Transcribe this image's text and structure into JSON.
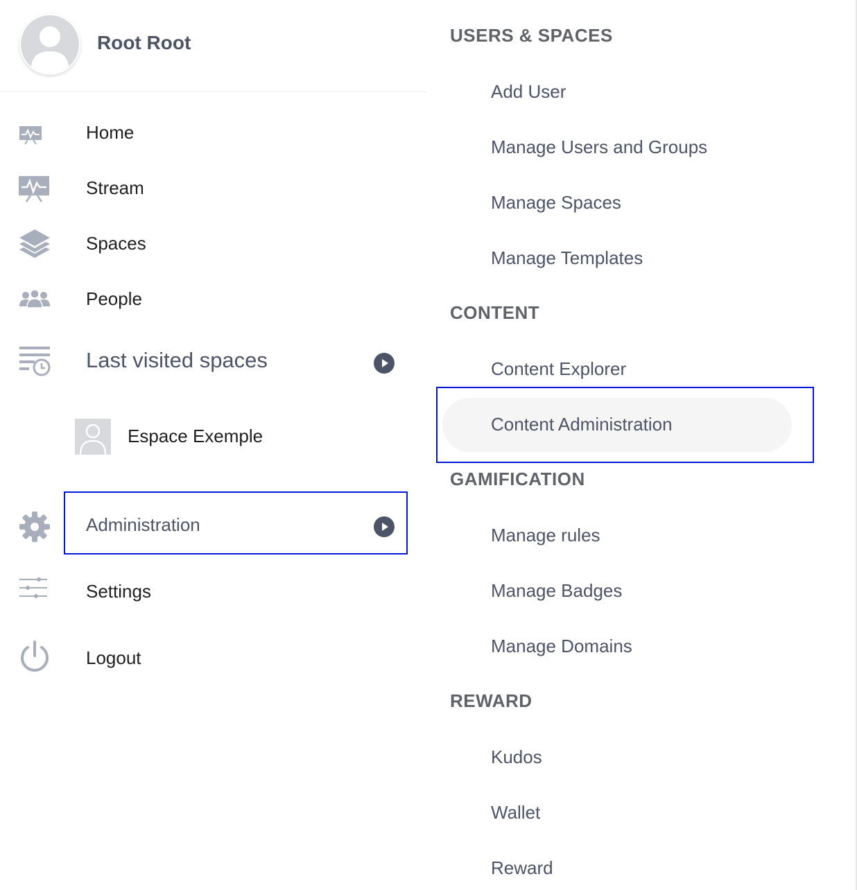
{
  "profile": {
    "name": "Root Root"
  },
  "nav": {
    "home": "Home",
    "stream": "Stream",
    "spaces": "Spaces",
    "people": "People",
    "last_visited": "Last visited spaces",
    "space_item": "Espace Exemple",
    "administration": "Administration",
    "settings": "Settings",
    "logout": "Logout"
  },
  "icons": {
    "home": "monitor-pulse-icon",
    "stream": "monitor-pulse-icon",
    "spaces": "layers-icon",
    "people": "people-icon",
    "last_visited": "history-list-icon",
    "administration": "gear-icon",
    "settings": "sliders-icon",
    "logout": "power-icon"
  },
  "admin_menu": {
    "users_spaces": {
      "title": "USERS & SPACES",
      "items": [
        "Add User",
        "Manage Users and Groups",
        "Manage Spaces",
        "Manage Templates"
      ]
    },
    "content": {
      "title": "CONTENT",
      "items": [
        "Content Explorer",
        "Content Administration"
      ]
    },
    "gamification": {
      "title": "GAMIFICATION",
      "items": [
        "Manage rules",
        "Manage Badges",
        "Manage Domains"
      ]
    },
    "reward": {
      "title": "REWARD",
      "items": [
        "Kudos",
        "Wallet",
        "Reward"
      ]
    }
  },
  "colors": {
    "highlight_border": "#0016d8",
    "icon_gray": "#a8aebb",
    "text_dark": "#1f1f1f",
    "text_slate": "#4d5466",
    "section_gray": "#5f6368"
  }
}
